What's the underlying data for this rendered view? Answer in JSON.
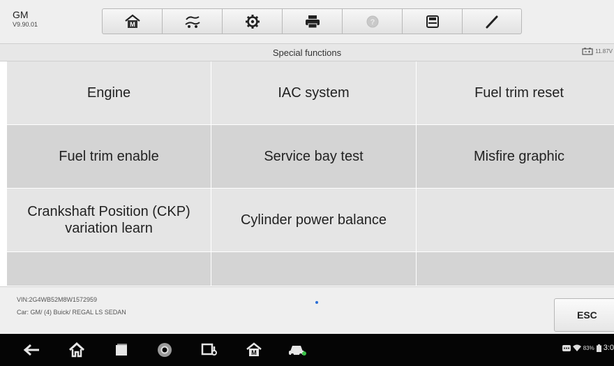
{
  "header": {
    "make": "GM",
    "version": "V9.90.01"
  },
  "toolbar": {
    "buttons": [
      {
        "icon": "home-icon"
      },
      {
        "icon": "vehicle-swap-icon"
      },
      {
        "icon": "settings-gear-icon"
      },
      {
        "icon": "print-icon"
      },
      {
        "icon": "help-icon",
        "disabled": true
      },
      {
        "icon": "save-icon"
      },
      {
        "icon": "edit-pen-icon"
      }
    ]
  },
  "titlebar": {
    "title": "Special functions",
    "voltage": "11.87V"
  },
  "functions": [
    "Engine",
    "IAC system",
    "Fuel trim reset",
    "Fuel trim enable",
    "Service bay test",
    "Misfire graphic",
    "Crankshaft Position (CKP) variation learn",
    "Cylinder power balance"
  ],
  "info": {
    "vin": "VIN:2G4WB52M8W1572959",
    "car": "Car: GM/ (4) Buick/ REGAL LS SEDAN",
    "esc_label": "ESC"
  },
  "statusbar": {
    "battery_percent": "83%",
    "time": "3:0"
  },
  "colors": {
    "cell_light": "#e5e5e5",
    "cell_dark": "#d4d4d4",
    "navbar": "#050505",
    "page_indicator": "#2a6ed6"
  }
}
